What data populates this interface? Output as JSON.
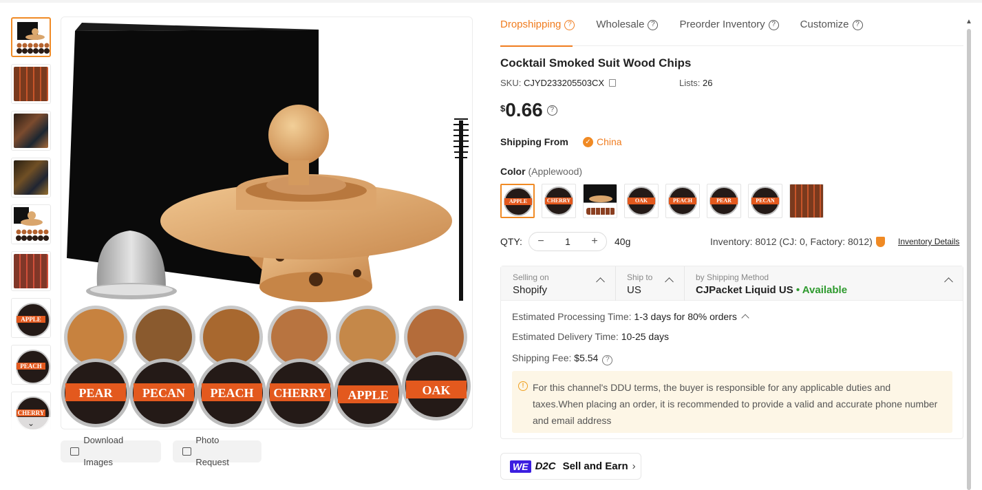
{
  "tabs": [
    {
      "label": "Dropshipping",
      "active": true
    },
    {
      "label": "Wholesale",
      "active": false
    },
    {
      "label": "Preorder Inventory",
      "active": false
    },
    {
      "label": "Customize",
      "active": false
    }
  ],
  "product": {
    "title": "Cocktail Smoked Suit Wood Chips",
    "sku_label": "SKU:",
    "sku_value": "CJYD233205503CX",
    "lists_label": "Lists:",
    "lists_value": "26",
    "currency": "$",
    "price": "0.66"
  },
  "shipping_from": {
    "label": "Shipping From",
    "country": "China"
  },
  "color": {
    "label": "Color",
    "selected": "(Applewood)",
    "swatches": [
      "APPLE",
      "CHERRY",
      "",
      "OAK",
      "PEACH",
      "PEAR",
      "PECAN",
      ""
    ]
  },
  "thumb_labels": [
    "APPLE",
    "PEACH",
    "CHERRY"
  ],
  "quantity": {
    "label": "QTY:",
    "value": "1",
    "minus": "−",
    "plus": "+",
    "weight": "40g"
  },
  "inventory": {
    "text": "Inventory: 8012  (CJ: 0, Factory: 8012)",
    "link": "Inventory Details"
  },
  "image_buttons": {
    "download": "Download Images",
    "photo": "Photo Request"
  },
  "main_image_labels": [
    "PEAR",
    "PECAN",
    "PEACH",
    "CHERRY",
    "APPLE",
    "OAK"
  ],
  "shipping": {
    "selling_on_label": "Selling on",
    "selling_on_value": "Shopify",
    "ship_to_label": "Ship to",
    "ship_to_value": "US",
    "method_label": "by Shipping Method",
    "method_value": "CJPacket Liquid US",
    "availability": "• Available",
    "processing_label": "Estimated Processing Time:",
    "processing_value": "1-3 days for 80% orders",
    "delivery_label": "Estimated Delivery Time:",
    "delivery_value": "10-25 days",
    "fee_label": "Shipping Fee:",
    "fee_value": "$5.54",
    "notice": "For this channel's DDU terms, the buyer is responsible for any applicable duties and taxes.When placing an order, it is recommended to provide a valid and accurate phone number and email address"
  },
  "d2c": {
    "we": "WE",
    "d2c": "D2C",
    "label": "Sell and Earn",
    "arrow": "›"
  },
  "colors": {
    "accent": "#f07c1e",
    "available": "#2e9a2e",
    "label_band": "#e3591e",
    "we_badge": "#3b1ee0"
  }
}
